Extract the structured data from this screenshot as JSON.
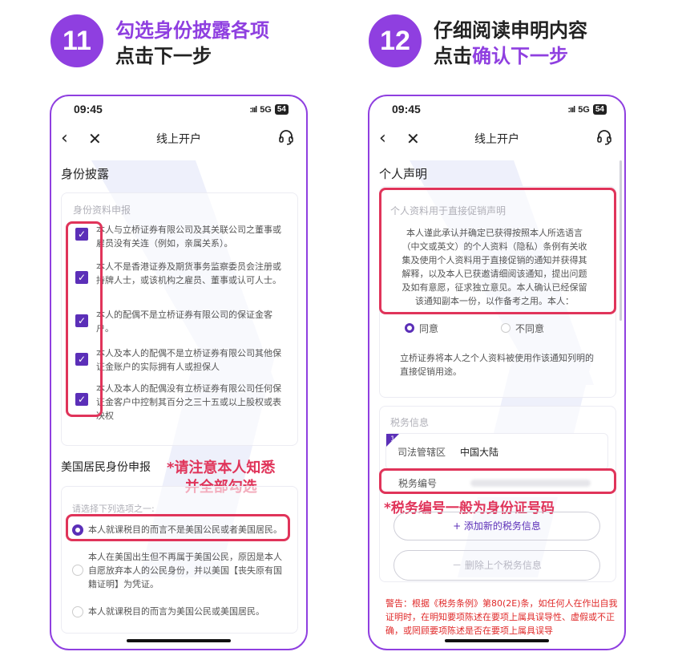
{
  "left_step": {
    "number": "11",
    "title_line1": "勾选身份披露各项",
    "title_line2": "点击下一步"
  },
  "right_step": {
    "number": "12",
    "title_line1": "仔细阅读申明内容",
    "title_line2_prefix": "点击",
    "title_line2_highlight": "确认下一步"
  },
  "status": {
    "time": "09:45",
    "signal": ":ııl",
    "network": "5G",
    "battery": "54"
  },
  "nav": {
    "title": "线上开户",
    "back_icon": "‹",
    "close_icon": "✕"
  },
  "left": {
    "heading": "身份披露",
    "card_title": "身份资料申报",
    "checks": [
      "本人与立桥证券有限公司及其关联公司之董事或雇员没有关连（例如，亲属关系）。",
      "本人不是香港证券及期货事务监察委员会注册或持牌人士，或该机构之雇员、董事或认可人士。",
      "本人的配偶不是立桥证券有限公司的保证金客户。",
      "本人及本人的配偶不是立桥证券有限公司其他保证金账户的实际拥有人或担保人",
      "本人及本人的配偶没有立桥证券有限公司任何保证金客户中控制其百分之三十五或以上股权或表决权"
    ],
    "us_heading": "美国居民身份申报",
    "us_prompt": "请选择下列选项之一:",
    "options": [
      "本人就课税目的而言不是美国公民或者美国居民。",
      "本人在美国出生但不再属于美国公民，原因是本人自愿放弃本人的公民身份，并以美国【丧失原有国籍证明】为凭证。",
      "本人就课税目的而言为美国公民或美国居民。"
    ],
    "annotation_line1": "*请注意本人知悉",
    "annotation_line2": "并全部勾选"
  },
  "right": {
    "heading": "个人声明",
    "decl_title": "个人资料用于直接促销声明",
    "decl_text": "本人谨此承认并确定已获得按照本人所选语言（中文或英文）的个人资料（隐私）条例有关收集及使用个人资料用于直接促销的通知并获得其解释，以及本人已获邀请细阅该通知，提出问题及如有意愿，征求独立意见。本人确认已经保留该通知副本一份，以作备考之用。本人：",
    "agree": "同意",
    "disagree": "不同意",
    "note": "立桥证券将本人之个人资料被使用作该通知列明的直接促销用途。",
    "tax_card_title": "税务信息",
    "tax_index": "1",
    "jurisdiction_label": "司法管辖区",
    "jurisdiction_value": "中国大陆",
    "tax_no_label": "税务编号",
    "annotation": "*税务编号一般为身份证号码",
    "add_button": "+ 添加新的税务信息",
    "delete_button": "－ 删除上个税务信息",
    "warning": "警告：根据《税务条例》第80(2E)条，如任何人在作出自我证明时，在明知要项陈述在要项上属具误导性、虚假或不正确，或罔顾要项陈述是否在要项上属具误导"
  },
  "colors": {
    "brand": "#8f3fe0",
    "checkbox": "#5b2fb8",
    "annotation": "#e0345a",
    "warning": "#e02a2a"
  }
}
